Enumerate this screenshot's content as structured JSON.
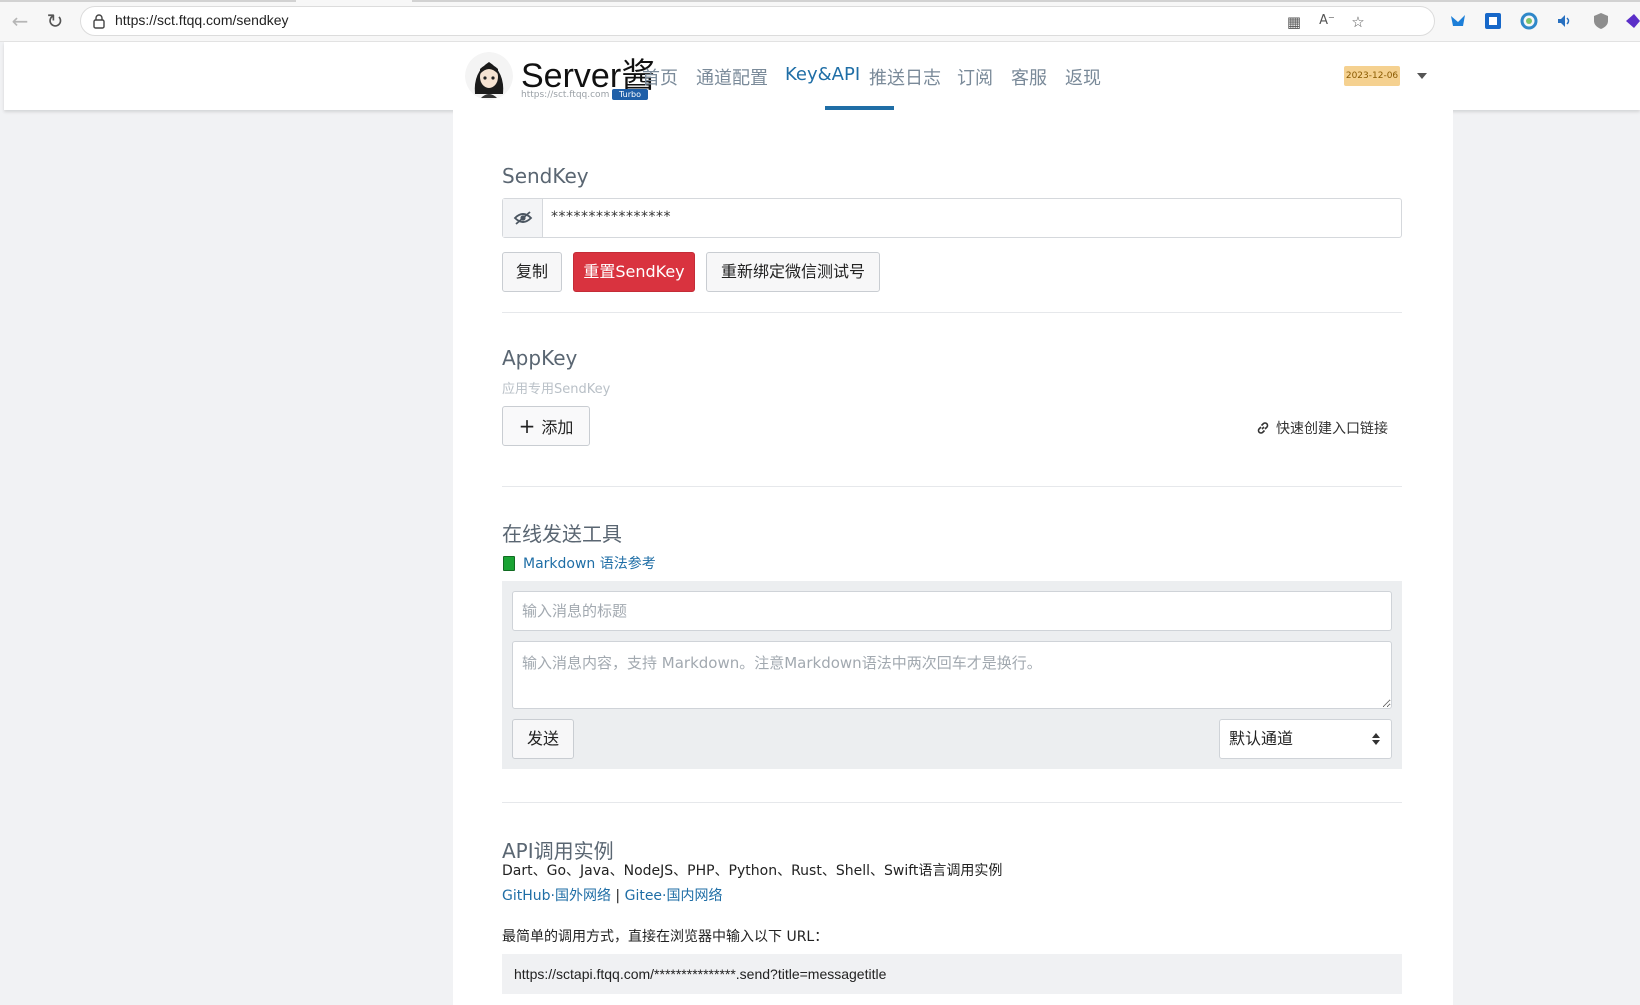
{
  "browser": {
    "url": "https://sct.ftqq.com/sendkey"
  },
  "header": {
    "brand": "Server酱",
    "brand_url": "https://sct.ftqq.com",
    "badge": "Turbo",
    "nav": [
      "首页",
      "通道配置",
      "Key&API",
      "推送日志",
      "订阅",
      "客服",
      "返现"
    ],
    "active_nav": "Key&API",
    "date_badge": "2023-12-06"
  },
  "sendkey": {
    "title": "SendKey",
    "value": "****************",
    "buttons": {
      "copy": "复制",
      "reset": "重置SendKey",
      "rebind": "重新绑定微信测试号"
    }
  },
  "appkey": {
    "title": "AppKey",
    "hint": "应用专用SendKey",
    "add_label": "添加",
    "quick_link": "快速创建入口链接"
  },
  "online_tool": {
    "title": "在线发送工具",
    "markdown_ref": "Markdown 语法参考",
    "title_placeholder": "输入消息的标题",
    "content_placeholder": "输入消息内容，支持 Markdown。注意Markdown语法中两次回车才是换行。",
    "send_label": "发送",
    "channel_selected": "默认通道"
  },
  "api": {
    "title": "API调用实例",
    "languages": "Dart、Go、Java、NodeJS、PHP、Python、Rust、Shell、Swift语言调用实例",
    "github_link": "GitHub·国外网络",
    "separator": "|",
    "gitee_link": "Gitee·国内网络",
    "simple_desc": "最简单的调用方式，直接在浏览器中输入以下 URL：",
    "example_url": "https://sctapi.ftqq.com/***************.send?title=messagetitle"
  },
  "colors": {
    "accent": "#1f6ea6",
    "danger": "#d9333f",
    "date_badge_bg": "#f5d190"
  }
}
